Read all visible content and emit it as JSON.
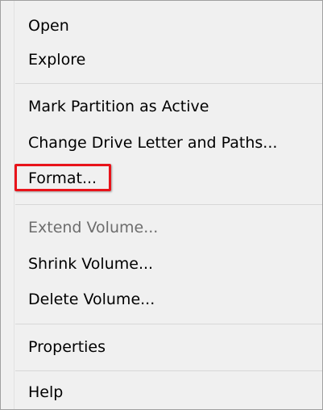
{
  "menu": {
    "items": [
      {
        "label": "Open",
        "enabled": true
      },
      {
        "label": "Explore",
        "enabled": true
      },
      {
        "label": "Mark Partition as Active",
        "enabled": true
      },
      {
        "label": "Change Drive Letter and Paths...",
        "enabled": true
      },
      {
        "label": "Format...",
        "enabled": true,
        "highlighted": true
      },
      {
        "label": "Extend Volume...",
        "enabled": false
      },
      {
        "label": "Shrink Volume...",
        "enabled": true
      },
      {
        "label": "Delete Volume...",
        "enabled": true
      },
      {
        "label": "Properties",
        "enabled": true
      },
      {
        "label": "Help",
        "enabled": true
      }
    ]
  },
  "colors": {
    "menu_background": "#f0f0f0",
    "highlight_border": "#e8131a",
    "disabled_text": "#6d6d6d"
  }
}
